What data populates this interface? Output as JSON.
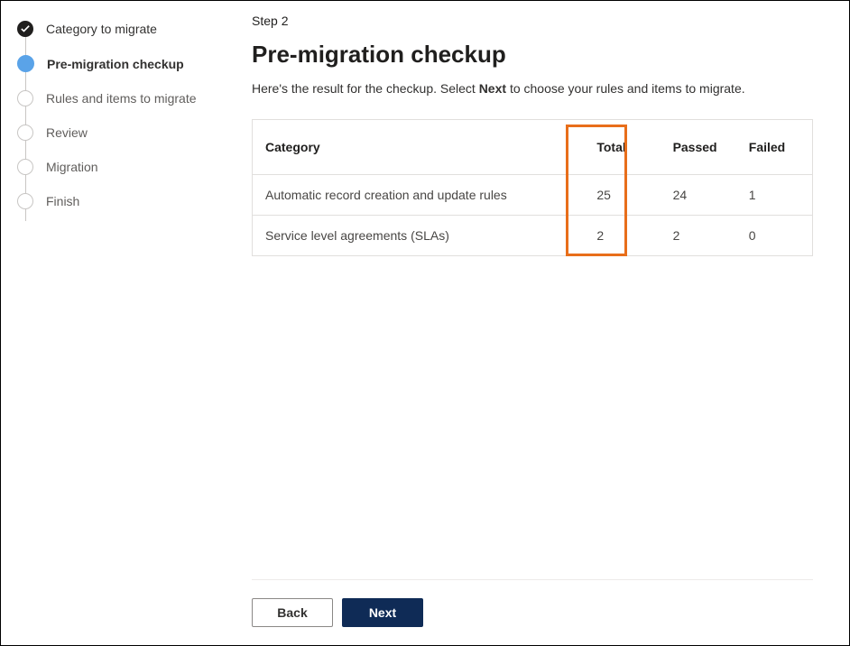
{
  "sidebar": {
    "steps": [
      {
        "label": "Category to migrate"
      },
      {
        "label": "Pre-migration checkup"
      },
      {
        "label": "Rules and items to migrate"
      },
      {
        "label": "Review"
      },
      {
        "label": "Migration"
      },
      {
        "label": "Finish"
      }
    ]
  },
  "main": {
    "step_label": "Step 2",
    "title": "Pre-migration checkup",
    "description_before": "Here's the result for the checkup. Select ",
    "description_next": "Next",
    "description_after": " to choose your rules and items to migrate."
  },
  "table": {
    "headers": {
      "category": "Category",
      "total": "Total",
      "passed": "Passed",
      "failed": "Failed"
    },
    "rows": [
      {
        "category": "Automatic record creation and update rules",
        "total": "25",
        "passed": "24",
        "failed": "1"
      },
      {
        "category": "Service level agreements (SLAs)",
        "total": "2",
        "passed": "2",
        "failed": "0"
      }
    ]
  },
  "footer": {
    "back": "Back",
    "next": "Next"
  }
}
